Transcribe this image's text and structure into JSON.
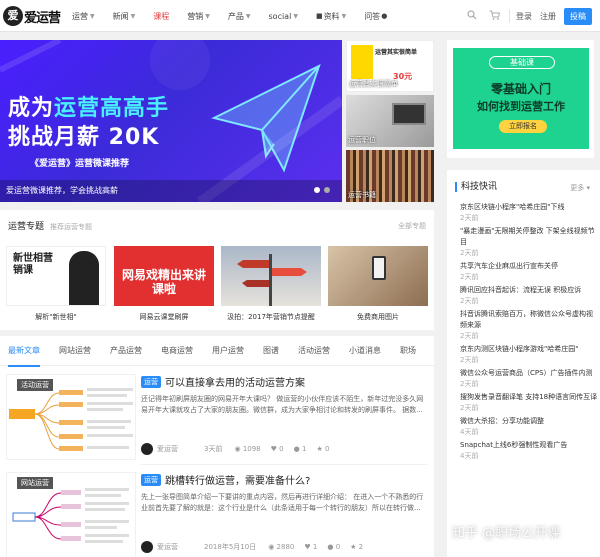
{
  "header": {
    "logo": "爱运营",
    "nav": [
      {
        "label": "运营",
        "caret": true,
        "active": false
      },
      {
        "label": "新闻",
        "caret": true,
        "active": false
      },
      {
        "label": "课程",
        "caret": false,
        "active": true
      },
      {
        "label": "营销",
        "caret": true,
        "active": false
      },
      {
        "label": "产品",
        "caret": true,
        "active": false
      },
      {
        "label": "social",
        "caret": true,
        "active": false
      },
      {
        "label": "资料",
        "caret": true,
        "active": false,
        "icon": "book-icon"
      },
      {
        "label": "问答",
        "caret": false,
        "active": false,
        "icon": "chat-icon"
      }
    ],
    "login": "登录",
    "register": "注册",
    "post_button": "投稿",
    "icons": [
      "search-icon",
      "cart-icon"
    ]
  },
  "hero": {
    "line1_a": "成为",
    "line1_b": "运营高高手",
    "line2": "挑战月薪 20K",
    "subtitle": "《爱运营》运营微课推荐",
    "caption": "爱运营微课推荐，学会挑战高薪",
    "slides": 2,
    "active_slide": 1
  },
  "side_thumbs": [
    {
      "caption": "运营其实很简单",
      "book_title": "运营其实很简单",
      "price": "30元"
    },
    {
      "caption": "运营职位"
    },
    {
      "caption": "运营书籍"
    }
  ],
  "topics": {
    "title": "运营专题",
    "subtitle": "推荐运营专题",
    "all": "全部专题",
    "items": [
      {
        "label": "解析\"新世相\"",
        "img_text": "新世相营销课"
      },
      {
        "label": "网易云课堂刷屏",
        "img_text": "网易戏精出来讲课啦"
      },
      {
        "label": "汲拍：2017年营销节点提醒",
        "img_text": ""
      },
      {
        "label": "免费商用图片",
        "img_text": ""
      }
    ]
  },
  "tabs": [
    "最新文章",
    "网站运营",
    "产品运营",
    "电商运营",
    "用户运营",
    "图谱",
    "活动运营",
    "小道消息",
    "职场"
  ],
  "posts": [
    {
      "badge": "运营",
      "title": "可以直接拿去用的活动运营方案",
      "excerpt": "还记得年初刷屏朋友圈的网易开年大课吗？ 做运营的小伙伴应该不陌生，新年过完没多久网易开年大课就攻占了大家的朋友圈。微信群，成为大家争相讨论和转发的刷屏事件。 据数...",
      "author": "爱运营",
      "date": "3天前",
      "views": "1098",
      "likes": "0",
      "comments": "1",
      "shares": "0",
      "thumb_text": "活动运营"
    },
    {
      "badge": "运营",
      "title": "跳槽转行做运营，需要准备什么?",
      "excerpt": "先上一张导图简单介绍一下要讲的重点内容，然后再进行详细介绍： 在进入一个不熟悉的行业前首先要了解的就是：这个行业是什么（此条适用于每一个转行的朋友）所以在转行做...",
      "author": "爱运营",
      "date": "2018年5月10日",
      "views": "2880",
      "likes": "1",
      "comments": "0",
      "shares": "2",
      "thumb_text": "网站运营"
    }
  ],
  "ad": {
    "tag": "基础课",
    "line1": "零基础入门",
    "line2": "如何找到运营工作",
    "button": "立即报名"
  },
  "news": {
    "title": "科技快讯",
    "more": "更多",
    "items": [
      {
        "text": "京东区块链小程序\"哈希庄园\"下线",
        "time": "2天前"
      },
      {
        "text": "\"暴走漫画\"无限期关停整改 下架全线视频节目",
        "time": "2天前"
      },
      {
        "text": "共享汽车企业麻瓜出行宣布关停",
        "time": "2天前"
      },
      {
        "text": "腾讯回应抖音起诉：流程无误 积极应诉",
        "time": "2天前"
      },
      {
        "text": "抖音诉腾讯索赔百万，称微信公众号虚构视频来源",
        "time": "2天前"
      },
      {
        "text": "京东内测区块链小程序游戏\"哈希庄园\"",
        "time": "2天前"
      },
      {
        "text": "微信公众号运营商品（CPS）广告插件内测",
        "time": "2天前"
      },
      {
        "text": "搜狗发售录音翻译笔 支持18种语言同传互译",
        "time": "2天前"
      },
      {
        "text": "微信大杀招：分享功能调整",
        "time": "4天前"
      },
      {
        "text": "Snapchat上线6秒强制性观看广告",
        "time": "4天前"
      }
    ]
  },
  "watermark": "知乎 @职场公开课",
  "colors": {
    "accent": "#2a8cf6",
    "active_nav": "#e23b3b",
    "hero_bg": "#4b1eff",
    "ad_bg": "#1ed38f"
  }
}
